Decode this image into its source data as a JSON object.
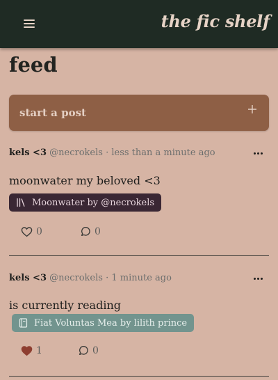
{
  "app": {
    "brand": "the fic shelf"
  },
  "page": {
    "title": "feed"
  },
  "composer": {
    "label": "start a post"
  },
  "posts": [
    {
      "author": "kels <3",
      "handle": "@necrokels",
      "separator": "·",
      "time": "less than a minute ago",
      "body": "moonwater my beloved <3",
      "tag": {
        "label": "Moonwater by @necrokels",
        "style": "collection",
        "color": "#3a2734"
      },
      "likes": "0",
      "liked": false,
      "comments": "0"
    },
    {
      "author": "kels <3",
      "handle": "@necrokels",
      "separator": "·",
      "time": "1 minute ago",
      "body": "is currently reading",
      "tag": {
        "label": "Fiat Voluntas Mea by lilith prince",
        "style": "book",
        "color": "#72948e"
      },
      "likes": "1",
      "liked": true,
      "comments": "0"
    }
  ],
  "icons": {
    "menu": "hamburger-icon",
    "add": "plus-icon",
    "more": "more-horizontal-icon",
    "collection": "library-icon",
    "book": "book-icon",
    "like": "heart-icon",
    "comment": "comment-icon"
  },
  "colors": {
    "background": "#d6b4a4",
    "header": "#1f2b24",
    "composer": "#8e5f45",
    "liked_heart": "#8e3e30"
  }
}
